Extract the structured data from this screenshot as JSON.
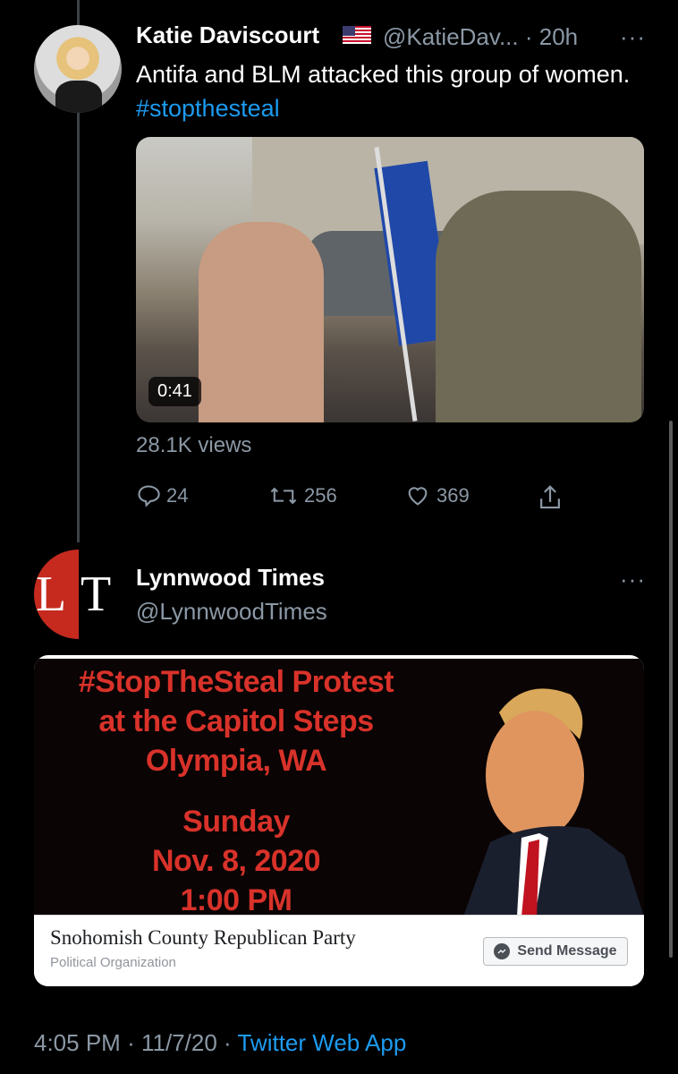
{
  "tweet": {
    "author_name": "Katie Daviscourt",
    "flag_emoji": "us-flag",
    "handle": "@KatieDav...",
    "time": "· 20h",
    "more": "···",
    "text_pre": "Antifa and BLM attacked this group of women. ",
    "hashtag": "#stopthesteal",
    "video_duration": "0:41",
    "views": "28.1K views",
    "replies": "24",
    "retweets": "256",
    "likes": "369"
  },
  "quoted": {
    "author_name": "Lynnwood Times",
    "handle": "@LynnwoodTimes",
    "more": "···",
    "avatar_letters": "LT",
    "poster_lines": [
      "#StopTheSteal Protest",
      "at the Capitol Steps",
      "Olympia, WA"
    ],
    "poster_date_lines": [
      "Sunday",
      "Nov. 8, 2020",
      "1:00 PM"
    ],
    "org_name": "Snohomish County Republican Party",
    "org_type": "Political Organization",
    "send_message": "Send Message"
  },
  "meta": {
    "time": "4:05 PM",
    "sep1": "·",
    "date": "11/7/20",
    "sep2": "·",
    "source": "Twitter Web App"
  },
  "colors": {
    "accent": "#1d9bf0",
    "secondary_text": "#8b98a5",
    "poster_red": "#d8322a"
  }
}
